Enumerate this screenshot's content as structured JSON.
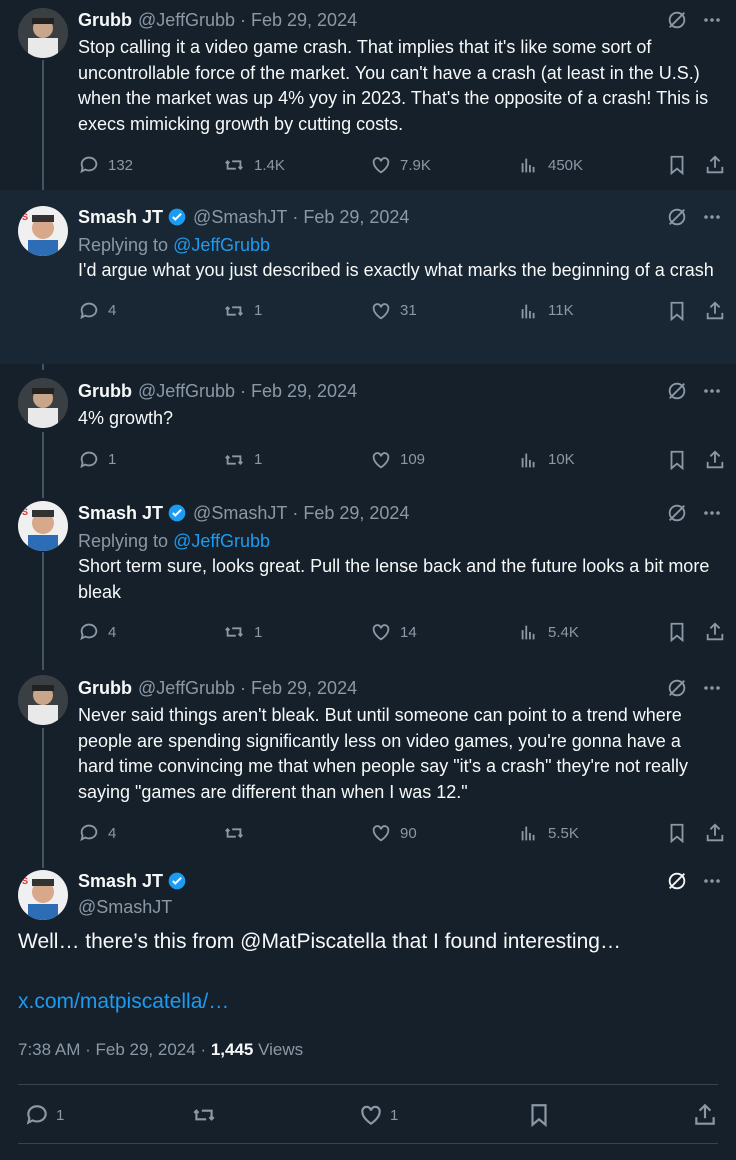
{
  "tweets": [
    {
      "name": "Grubb",
      "handle": "@JeffGrubb",
      "date": "Feb 29, 2024",
      "verified": false,
      "reply_to": null,
      "text": "Stop calling it a video game crash. That implies that it's like some sort of uncontrollable force of the market. You can't have a crash (at least in the U.S.) when the market was up 4% yoy in 2023. That's the opposite of a crash! This is execs mimicking growth by cutting costs.",
      "replies": "132",
      "retweets": "1.4K",
      "likes": "7.9K",
      "views": "450K"
    },
    {
      "name": "Smash JT",
      "handle": "@SmashJT",
      "date": "Feb 29, 2024",
      "verified": true,
      "reply_prefix": "Replying to ",
      "reply_to": "@JeffGrubb",
      "text": "I'd argue what you just described is exactly what marks the beginning of a crash",
      "replies": "4",
      "retweets": "1",
      "likes": "31",
      "views": "11K"
    },
    {
      "name": "Grubb",
      "handle": "@JeffGrubb",
      "date": "Feb 29, 2024",
      "verified": false,
      "reply_to": null,
      "text": "4% growth?",
      "replies": "1",
      "retweets": "1",
      "likes": "109",
      "views": "10K"
    },
    {
      "name": "Smash JT",
      "handle": "@SmashJT",
      "date": "Feb 29, 2024",
      "verified": true,
      "reply_prefix": "Replying to ",
      "reply_to": "@JeffGrubb",
      "text": "Short term sure, looks great. Pull the lense back and the future looks a bit more bleak",
      "replies": "4",
      "retweets": "1",
      "likes": "14",
      "views": "5.4K"
    },
    {
      "name": "Grubb",
      "handle": "@JeffGrubb",
      "date": "Feb 29, 2024",
      "verified": false,
      "reply_to": null,
      "text": "Never said things aren't bleak. But until someone can point to a trend where people are spending significantly less on video games, you're gonna have a hard time convincing me that when people say \"it's a crash\" they're not really saying \"games are different than when I was 12.\"",
      "replies": "4",
      "retweets": "",
      "likes": "90",
      "views": "5.5K"
    }
  ],
  "main": {
    "name": "Smash JT",
    "handle": "@SmashJT",
    "text": "Well… there’s this from @MatPiscatella that I found interesting…",
    "link": "x.com/matpiscatella/…",
    "time": "7:38 AM",
    "date": "Feb 29, 2024",
    "views_count": "1,445",
    "views_label": "Views",
    "replies": "1",
    "likes": "1"
  },
  "colors": {
    "background": "#15202b",
    "accent": "#1d9bf0",
    "muted": "#8b98a5"
  },
  "icons": [
    "reply-icon",
    "retweet-icon",
    "like-icon",
    "views-icon",
    "bookmark-icon",
    "share-icon",
    "grok-icon",
    "more-icon",
    "verified-icon"
  ]
}
